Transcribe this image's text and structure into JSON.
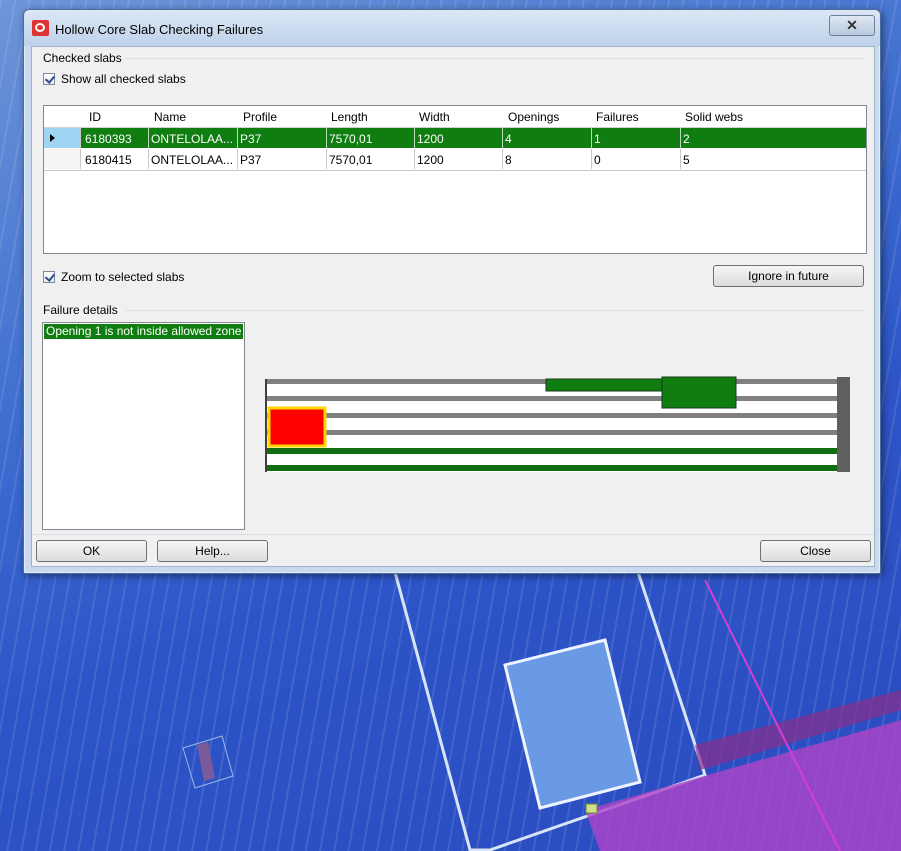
{
  "window": {
    "title": "Hollow Core Slab Checking Failures",
    "close_glyph": "✕"
  },
  "checked_slabs": {
    "group_label": "Checked slabs",
    "show_all_label": "Show all checked slabs",
    "show_all_checked": true,
    "columns": [
      "ID",
      "Name",
      "Profile",
      "Length",
      "Width",
      "Openings",
      "Failures",
      "Solid webs"
    ],
    "rows": [
      {
        "id": "6180393",
        "name": "ONTELOLAA...",
        "profile": "P37",
        "length": "7570,01",
        "width": "1200",
        "openings": "4",
        "failures": "1",
        "solid_webs": "2",
        "selected": true
      },
      {
        "id": "6180415",
        "name": "ONTELOLAA...",
        "profile": "P37",
        "length": "7570,01",
        "width": "1200",
        "openings": "8",
        "failures": "0",
        "solid_webs": "5",
        "selected": false
      }
    ],
    "zoom_label": "Zoom to selected slabs",
    "zoom_checked": true,
    "ignore_button": "Ignore in future"
  },
  "failure_details": {
    "group_label": "Failure details",
    "items": [
      "Opening 1 is not inside allowed zone"
    ]
  },
  "footer": {
    "ok": "OK",
    "help": "Help...",
    "close": "Close"
  },
  "colors": {
    "selection": "#0f7d0f",
    "failure_highlight": "#ff0000",
    "failure_outline": "#ffd700",
    "web": "#808080"
  }
}
